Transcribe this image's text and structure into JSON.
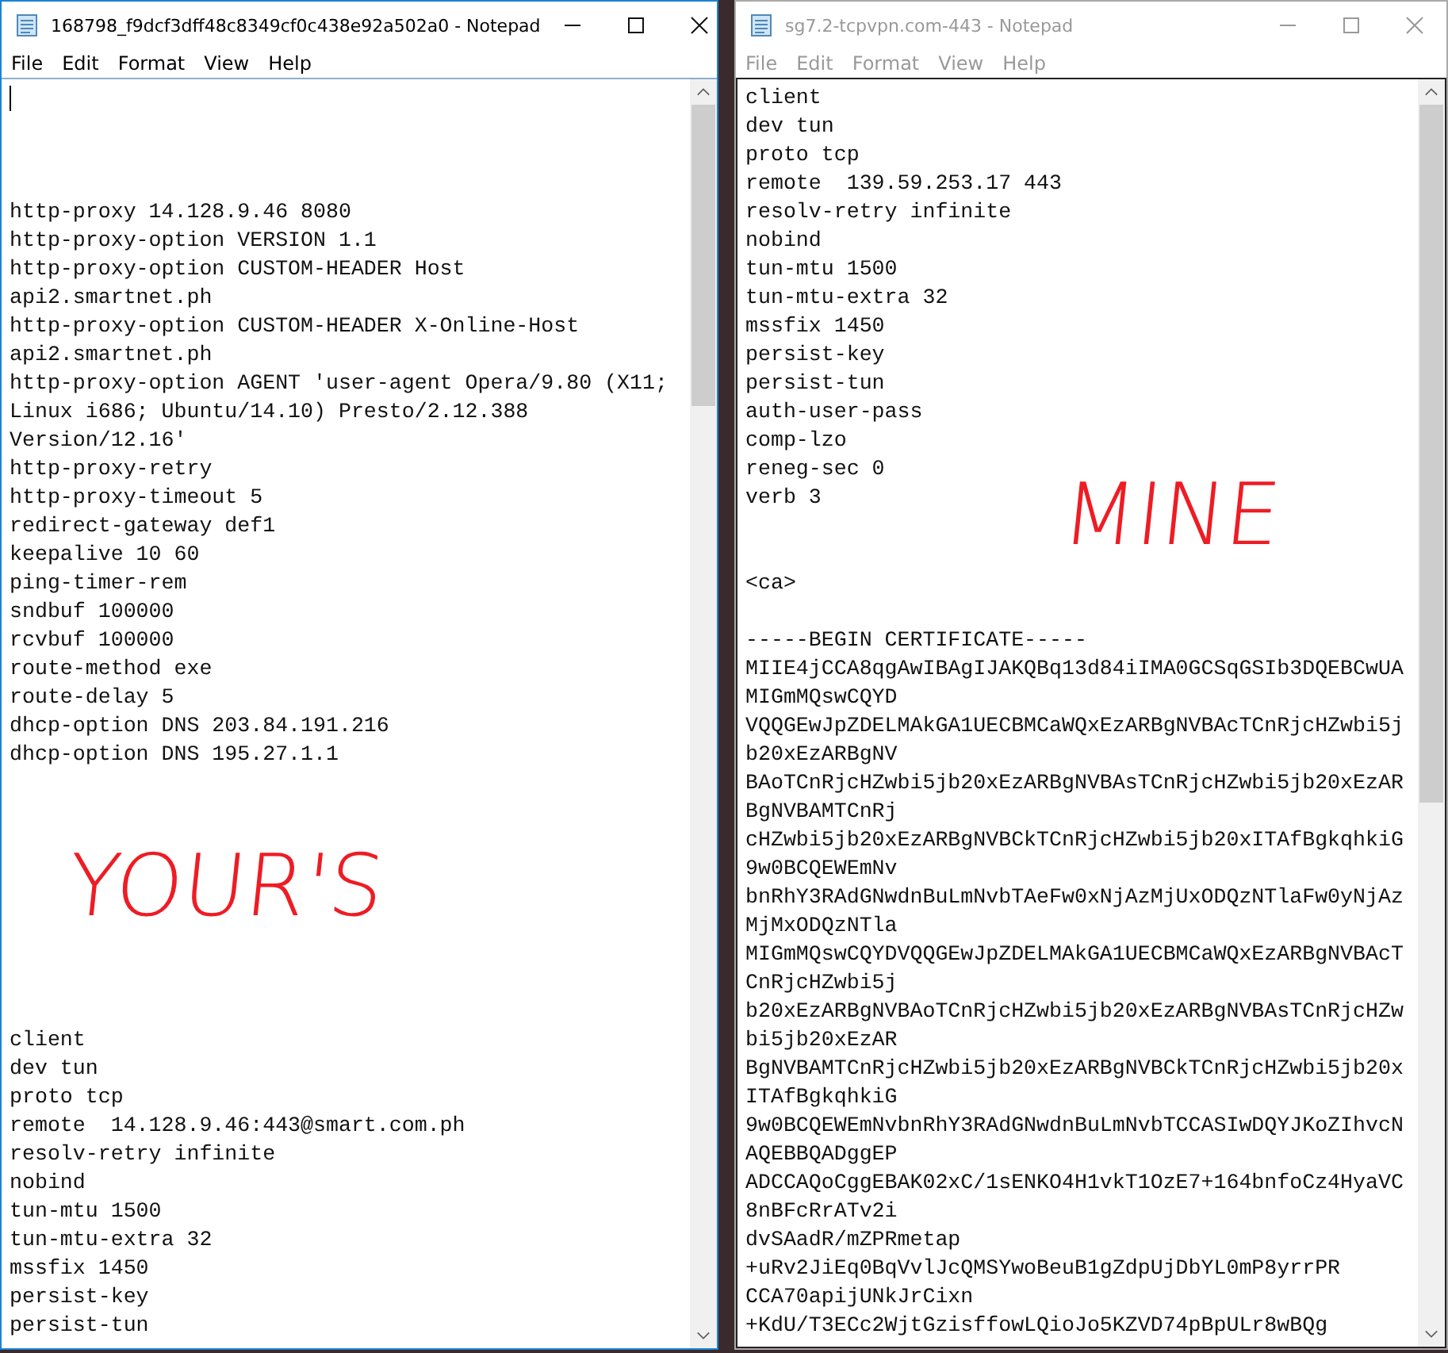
{
  "windows": [
    {
      "title": "168798_f9dcf3dff48c8349cf0c438e92a502a0 - Notepad",
      "active": true,
      "caret": true,
      "menu": [
        "File",
        "Edit",
        "Format",
        "View",
        "Help"
      ],
      "blocks": [
        {
          "lines": [
            "http-proxy 14.128.9.46 8080",
            "http-proxy-option VERSION 1.1",
            "http-proxy-option CUSTOM-HEADER Host",
            "api2.smartnet.ph",
            "http-proxy-option CUSTOM-HEADER X-Online-Host",
            "api2.smartnet.ph",
            "http-proxy-option AGENT 'user-agent Opera/9.80 (X11;",
            "Linux i686; Ubuntu/14.10) Presto/2.12.388",
            "Version/12.16'",
            "http-proxy-retry",
            "http-proxy-timeout 5",
            "redirect-gateway def1",
            "keepalive 10 60",
            "ping-timer-rem",
            "sndbuf 100000",
            "rcvbuf 100000",
            "route-method exe",
            "route-delay 5",
            "dhcp-option DNS 203.84.191.216",
            "dhcp-option DNS 195.27.1.1"
          ]
        },
        {
          "lines": [
            "client",
            "dev tun",
            "proto tcp",
            "remote  14.128.9.46:443@smart.com.ph",
            "resolv-retry infinite",
            "nobind",
            "tun-mtu 1500",
            "tun-mtu-extra 32",
            "mssfix 1450",
            "persist-key",
            "persist-tun"
          ]
        }
      ],
      "note": "YOUR'S"
    },
    {
      "title": "sg7.2-tcpvpn.com-443 - Notepad",
      "active": false,
      "caret": false,
      "menu": [
        "File",
        "Edit",
        "Format",
        "View",
        "Help"
      ],
      "blocks": [
        {
          "lines": [
            "client",
            "dev tun",
            "proto tcp",
            "remote  139.59.253.17 443",
            "resolv-retry infinite",
            "nobind",
            "tun-mtu 1500",
            "tun-mtu-extra 32",
            "mssfix 1450",
            "persist-key",
            "persist-tun",
            "auth-user-pass",
            "comp-lzo",
            "reneg-sec 0",
            "verb 3"
          ]
        },
        {
          "lines": [
            "<ca>"
          ]
        },
        {
          "lines": [
            "-----BEGIN CERTIFICATE-----",
            "MIIE4jCCA8qgAwIBAgIJAKQBq13d84iIMA0GCSqGSIb3DQEBCwUA",
            "MIGmMQswCQYD",
            "VQQGEwJpZDELMAkGA1UECBMCaWQxEzARBgNVBAcTCnRjcHZwbi5j",
            "b20xEzARBgNV",
            "BAoTCnRjcHZwbi5jb20xEzARBgNVBAsTCnRjcHZwbi5jb20xEzAR",
            "BgNVBAMTCnRj",
            "cHZwbi5jb20xEzARBgNVBCkTCnRjcHZwbi5jb20xITAfBgkqhkiG",
            "9w0BCQEWEmNv",
            "bnRhY3RAdGNwdnBuLmNvbTAeFw0xNjAzMjUxODQzNTlaFw0yNjAz",
            "MjMxODQzNTla",
            "MIGmMQswCQYDVQQGEwJpZDELMAkGA1UECBMCaWQxEzARBgNVBAcT",
            "CnRjcHZwbi5j",
            "b20xEzARBgNVBAoTCnRjcHZwbi5jb20xEzARBgNVBAsTCnRjcHZw",
            "bi5jb20xEzAR",
            "BgNVBAMTCnRjcHZwbi5jb20xEzARBgNVBCkTCnRjcHZwbi5jb20x",
            "ITAfBgkqhkiG",
            "9w0BCQEWEmNvbnRhY3RAdGNwdnBuLmNvbTCCASIwDQYJKoZIhvcN",
            "AQEBBQADggEP",
            "ADCCAQoCggEBAK02xC/1sENKO4H1vkT1OzE7+164bnfoCz4HyaVC",
            "8nBFcRrATv2i",
            "dvSAadR/mZPRmetap",
            "+uRv2JiEq0BqVvlJcQMSYwoBeuB1gZdpUjDbYL0mP8yrrPR",
            "CCA70apijUNkJrCixn",
            "+KdU/T3ECc2WjtGzisffowLQioJo5KZVD74pBpULr8wBQg"
          ]
        }
      ],
      "note": "MINE"
    }
  ]
}
